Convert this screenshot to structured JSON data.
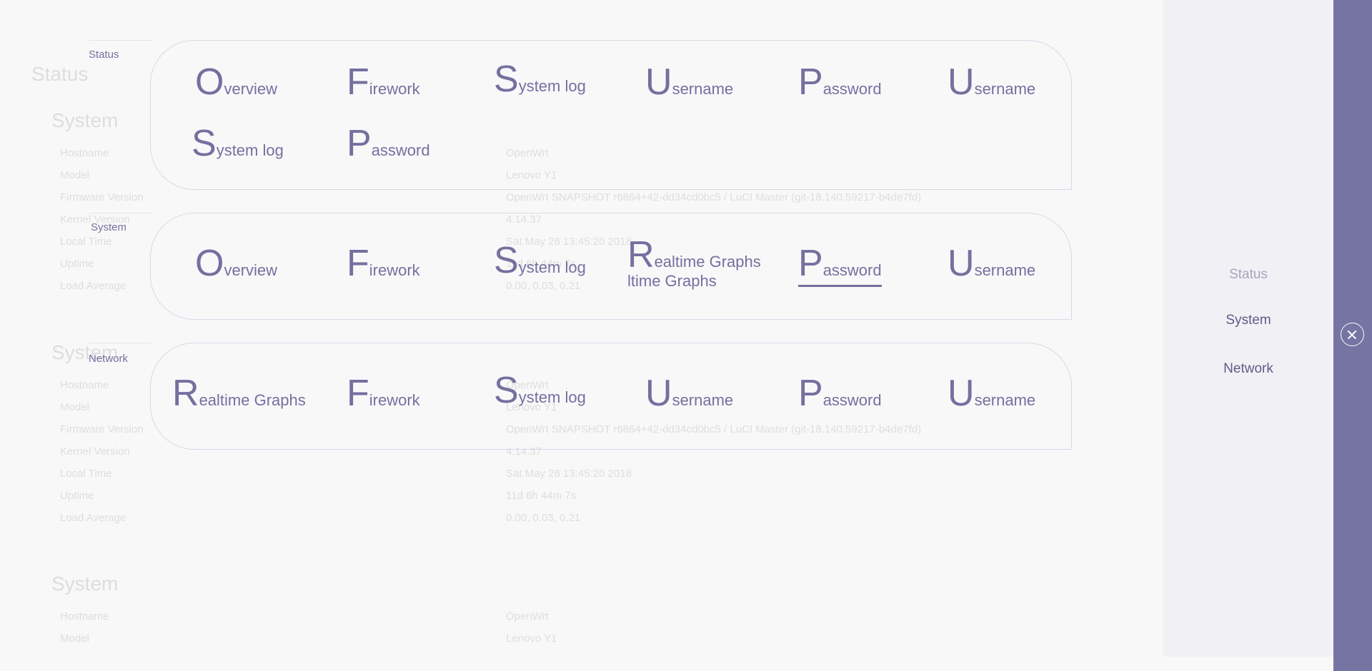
{
  "background": {
    "page_title": "Status",
    "sections": [
      {
        "title": "System",
        "rows": [
          [
            "Hostname",
            "OpenWrt"
          ],
          [
            "Model",
            "Lenovo Y1"
          ],
          [
            "Firmware Version",
            "OpenWrt SNAPSHOT r6864+42-dd34cd0bc5 / LuCI Master (git-18.140.59217-b4de7fd)"
          ],
          [
            "Kernel Version",
            "4.14.37"
          ],
          [
            "Local Time",
            "Sat May 26 13:45:20 2018"
          ],
          [
            "Uptime",
            "11d 6h 44m 7s"
          ],
          [
            "Load Average",
            "0.00, 0.03, 0.21"
          ]
        ]
      },
      {
        "title": "System",
        "rows": [
          [
            "Hostname",
            "OpenWrt"
          ],
          [
            "Model",
            "Lenovo Y1"
          ],
          [
            "Firmware Version",
            "OpenWrt SNAPSHOT r6864+42-dd34cd0bc5 / LuCI Master (git-18.140.59217-b4de7fd)"
          ],
          [
            "Kernel Version",
            "4.14.37"
          ],
          [
            "Local Time",
            "Sat May 26 13:45:20 2018"
          ],
          [
            "Uptime",
            "11d 6h 44m 7s"
          ],
          [
            "Load Average",
            "0.00, 0.03, 0.21"
          ]
        ]
      },
      {
        "title": "System",
        "rows": [
          [
            "Hostname",
            "OpenWrt"
          ],
          [
            "Model",
            "Lenovo Y1"
          ]
        ]
      }
    ]
  },
  "menu": {
    "groups": [
      {
        "label": "Status",
        "items": [
          {
            "initial": "O",
            "rest": "verview"
          },
          {
            "initial": "F",
            "rest": "irework"
          },
          {
            "initial": "S",
            "rest": "ystem log"
          },
          {
            "initial": "U",
            "rest": "sername"
          },
          {
            "initial": "P",
            "rest": "assword"
          },
          {
            "initial": "U",
            "rest": "sername"
          },
          {
            "initial": "S",
            "rest": "ystem log"
          },
          {
            "initial": "P",
            "rest": "assword"
          }
        ]
      },
      {
        "label": "System",
        "items": [
          {
            "initial": "O",
            "rest": "verview"
          },
          {
            "initial": "F",
            "rest": "irework"
          },
          {
            "initial": "S",
            "rest": "ystem log"
          },
          {
            "initial": "R",
            "rest": "ealtime Graphs"
          },
          {
            "initial": "P",
            "rest": "assword",
            "active": true
          },
          {
            "initial": "U",
            "rest": "sername"
          }
        ],
        "ghost_text": "ltime Graphs"
      },
      {
        "label": "Network",
        "items": [
          {
            "initial": "R",
            "rest": "ealtime Graphs"
          },
          {
            "initial": "F",
            "rest": "irework"
          },
          {
            "initial": "S",
            "rest": "ystem log"
          },
          {
            "initial": "U",
            "rest": "sername"
          },
          {
            "initial": "P",
            "rest": "assword"
          },
          {
            "initial": "U",
            "rest": "sername"
          }
        ]
      }
    ]
  },
  "side_nav": {
    "items": [
      "Status",
      "System",
      "Network"
    ]
  },
  "colors": {
    "accent": "#74709f",
    "sidebar": "#7574a3",
    "panel": "#f1f1f5"
  },
  "icons": {
    "close": "close-icon"
  }
}
